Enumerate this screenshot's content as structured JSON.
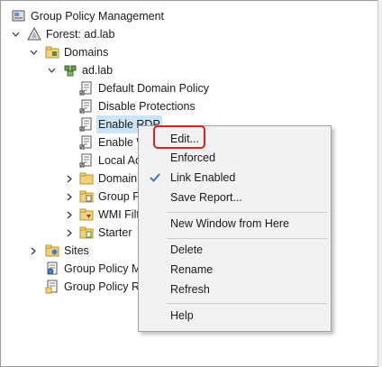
{
  "tree": {
    "root": "Group Policy Management",
    "forest": "Forest: ad.lab",
    "domains": "Domains",
    "domain": "ad.lab",
    "gpo_links": [
      "Default Domain Policy",
      "Disable Protections",
      "Enable RDP",
      "Enable W",
      "Local Ac"
    ],
    "folders": [
      "Domain",
      "Group P",
      "WMI Filt",
      "Starter"
    ],
    "sites": "Sites",
    "modeling": "Group Policy M",
    "results": "Group Policy R"
  },
  "context_menu": {
    "items": [
      "Edit...",
      "Enforced",
      "Link Enabled",
      "Save Report...",
      "New Window from Here",
      "Delete",
      "Rename",
      "Refresh",
      "Help"
    ],
    "checked_item": "Link Enabled"
  },
  "colors": {
    "selection": "#cce4f7",
    "menu_bg": "#f2f2f2",
    "highlight": "#e02020",
    "check": "#2a6fcb"
  }
}
